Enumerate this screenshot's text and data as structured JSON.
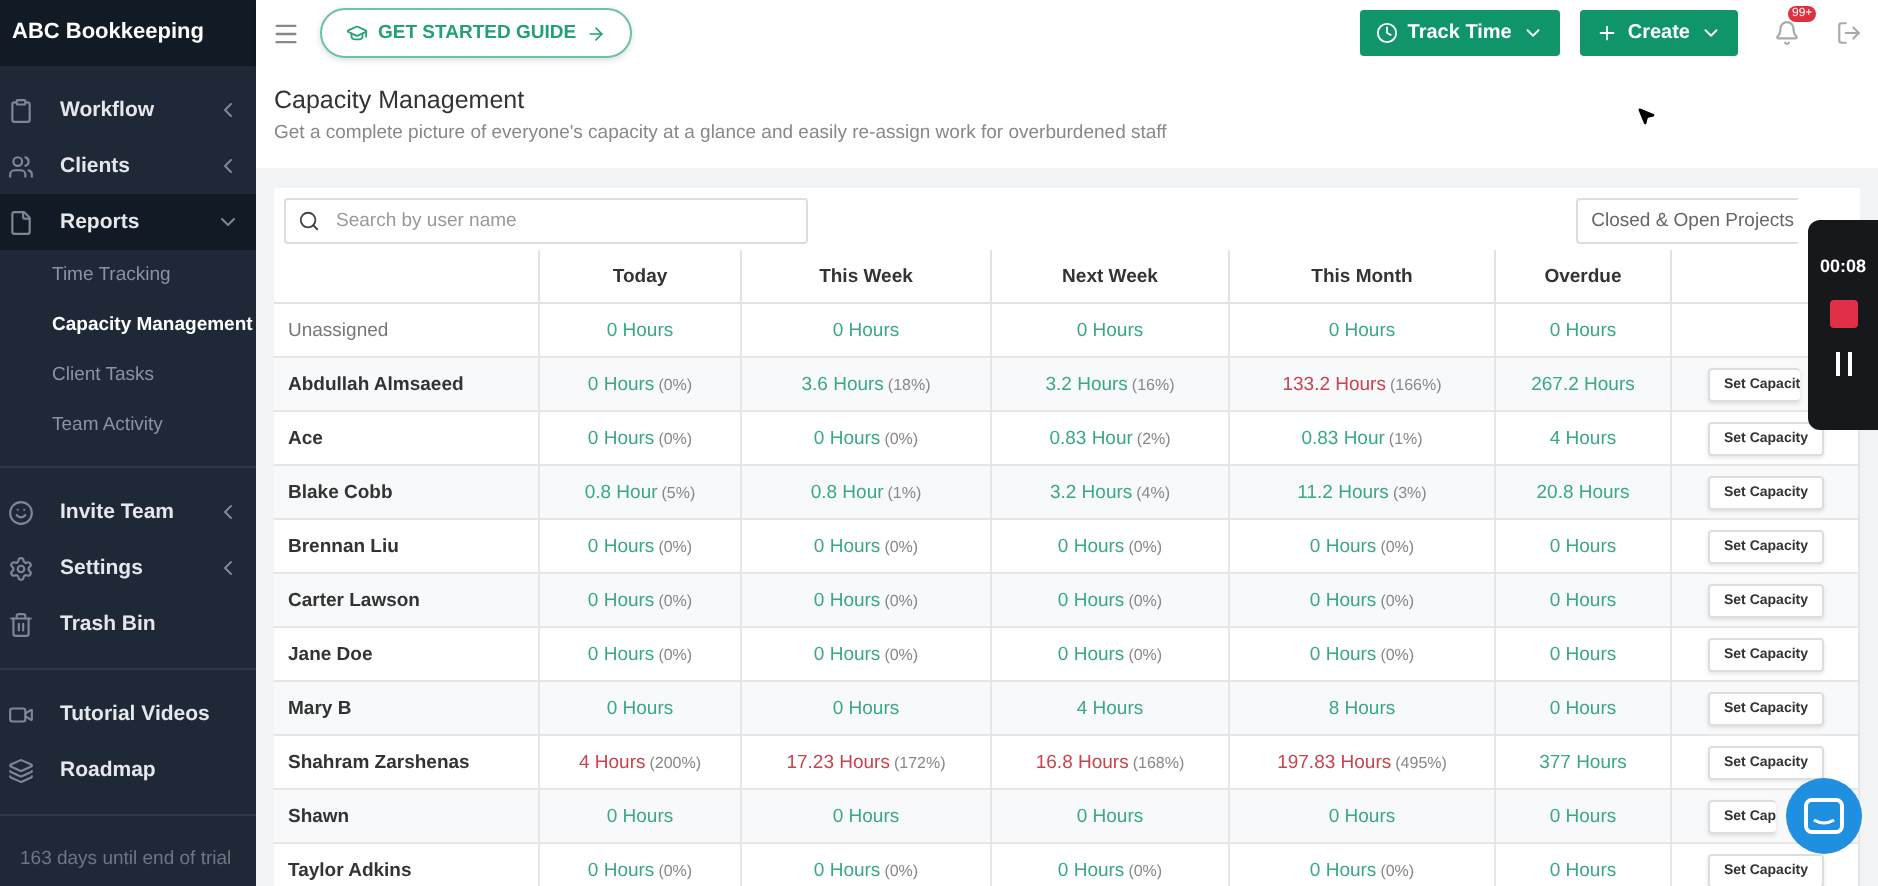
{
  "brand": "ABC Bookkeeping",
  "sidebar": {
    "groups": [
      {
        "items": [
          {
            "label": "Workflow",
            "expanded": false,
            "has_chevron": true
          },
          {
            "label": "Clients",
            "expanded": false,
            "has_chevron": true
          },
          {
            "label": "Reports",
            "expanded": true,
            "has_chevron": true,
            "children": [
              {
                "label": "Time Tracking",
                "selected": false
              },
              {
                "label": "Capacity Management",
                "selected": true
              },
              {
                "label": "Client Tasks",
                "selected": false
              },
              {
                "label": "Team Activity",
                "selected": false
              }
            ]
          }
        ]
      },
      {
        "items": [
          {
            "label": "Invite Team",
            "expanded": false,
            "has_chevron": true
          },
          {
            "label": "Settings",
            "expanded": false,
            "has_chevron": true
          },
          {
            "label": "Trash Bin",
            "expanded": false,
            "has_chevron": false
          }
        ]
      },
      {
        "items": [
          {
            "label": "Tutorial Videos",
            "expanded": false,
            "has_chevron": false
          },
          {
            "label": "Roadmap",
            "expanded": false,
            "has_chevron": false
          }
        ]
      }
    ],
    "trial_note": "163 days until end of trial"
  },
  "topbar": {
    "guide_button": "GET STARTED GUIDE",
    "track_button": "Track Time",
    "create_button": "Create",
    "notification_badge": "99+"
  },
  "page": {
    "title": "Capacity Management",
    "subtitle": "Get a complete picture of everyone's capacity at a glance and easily re-assign work for overburdened staff"
  },
  "search": {
    "placeholder": "Search by user name"
  },
  "filter": {
    "value": "Closed & Open Projects"
  },
  "table": {
    "columns": [
      "Today",
      "This Week",
      "Next Week",
      "This Month",
      "Overdue"
    ],
    "rows": [
      {
        "name": "Unassigned",
        "unassigned": true,
        "cells": [
          {
            "hours": "0 Hours",
            "over": false
          },
          {
            "hours": "0 Hours",
            "over": false
          },
          {
            "hours": "0 Hours",
            "over": false
          },
          {
            "hours": "0 Hours",
            "over": false
          },
          {
            "hours": "0 Hours",
            "over": false
          }
        ]
      },
      {
        "name": "Abdullah Almsaeed",
        "unassigned": false,
        "action": "Set Capacit",
        "action_cut": true,
        "cells": [
          {
            "hours": "0 Hours",
            "pct": "(0%)",
            "over": false
          },
          {
            "hours": "3.6 Hours",
            "pct": "(18%)",
            "over": false
          },
          {
            "hours": "3.2 Hours",
            "pct": "(16%)",
            "over": false
          },
          {
            "hours": "133.2 Hours",
            "pct": "(166%)",
            "over": true
          },
          {
            "hours": "267.2 Hours",
            "over": false
          }
        ]
      },
      {
        "name": "Ace",
        "unassigned": false,
        "action": "Set Capacity",
        "cells": [
          {
            "hours": "0 Hours",
            "pct": "(0%)",
            "over": false
          },
          {
            "hours": "0 Hours",
            "pct": "(0%)",
            "over": false
          },
          {
            "hours": "0.83 Hour",
            "pct": "(2%)",
            "over": false
          },
          {
            "hours": "0.83 Hour",
            "pct": "(1%)",
            "over": false
          },
          {
            "hours": "4 Hours",
            "over": false
          }
        ]
      },
      {
        "name": "Blake Cobb",
        "unassigned": false,
        "action": "Set Capacity",
        "cells": [
          {
            "hours": "0.8 Hour",
            "pct": "(5%)",
            "over": false
          },
          {
            "hours": "0.8 Hour",
            "pct": "(1%)",
            "over": false
          },
          {
            "hours": "3.2 Hours",
            "pct": "(4%)",
            "over": false
          },
          {
            "hours": "11.2 Hours",
            "pct": "(3%)",
            "over": false
          },
          {
            "hours": "20.8 Hours",
            "over": false
          }
        ]
      },
      {
        "name": "Brennan Liu",
        "unassigned": false,
        "action": "Set Capacity",
        "cells": [
          {
            "hours": "0 Hours",
            "pct": "(0%)",
            "over": false
          },
          {
            "hours": "0 Hours",
            "pct": "(0%)",
            "over": false
          },
          {
            "hours": "0 Hours",
            "pct": "(0%)",
            "over": false
          },
          {
            "hours": "0 Hours",
            "pct": "(0%)",
            "over": false
          },
          {
            "hours": "0 Hours",
            "over": false
          }
        ]
      },
      {
        "name": "Carter Lawson",
        "unassigned": false,
        "action": "Set Capacity",
        "cells": [
          {
            "hours": "0 Hours",
            "pct": "(0%)",
            "over": false
          },
          {
            "hours": "0 Hours",
            "pct": "(0%)",
            "over": false
          },
          {
            "hours": "0 Hours",
            "pct": "(0%)",
            "over": false
          },
          {
            "hours": "0 Hours",
            "pct": "(0%)",
            "over": false
          },
          {
            "hours": "0 Hours",
            "over": false
          }
        ]
      },
      {
        "name": "Jane Doe",
        "unassigned": false,
        "action": "Set Capacity",
        "cells": [
          {
            "hours": "0 Hours",
            "pct": "(0%)",
            "over": false
          },
          {
            "hours": "0 Hours",
            "pct": "(0%)",
            "over": false
          },
          {
            "hours": "0 Hours",
            "pct": "(0%)",
            "over": false
          },
          {
            "hours": "0 Hours",
            "pct": "(0%)",
            "over": false
          },
          {
            "hours": "0 Hours",
            "over": false
          }
        ]
      },
      {
        "name": "Mary B",
        "unassigned": false,
        "action": "Set Capacity",
        "cells": [
          {
            "hours": "0 Hours",
            "over": false
          },
          {
            "hours": "0 Hours",
            "over": false
          },
          {
            "hours": "4 Hours",
            "over": false
          },
          {
            "hours": "8 Hours",
            "over": false
          },
          {
            "hours": "0 Hours",
            "over": false
          }
        ]
      },
      {
        "name": "Shahram Zarshenas",
        "unassigned": false,
        "action": "Set Capacity",
        "cells": [
          {
            "hours": "4 Hours",
            "pct": "(200%)",
            "over": true
          },
          {
            "hours": "17.23 Hours",
            "pct": "(172%)",
            "over": true
          },
          {
            "hours": "16.8 Hours",
            "pct": "(168%)",
            "over": true
          },
          {
            "hours": "197.83 Hours",
            "pct": "(495%)",
            "over": true
          },
          {
            "hours": "377 Hours",
            "over": false
          }
        ]
      },
      {
        "name": "Shawn",
        "unassigned": false,
        "action": "Set Cap",
        "action_cut": true,
        "cells": [
          {
            "hours": "0 Hours",
            "over": false
          },
          {
            "hours": "0 Hours",
            "over": false
          },
          {
            "hours": "0 Hours",
            "over": false
          },
          {
            "hours": "0 Hours",
            "over": false
          },
          {
            "hours": "0 Hours",
            "over": false
          }
        ]
      },
      {
        "name": "Taylor Adkins",
        "unassigned": false,
        "action": "Set Capacity",
        "cells": [
          {
            "hours": "0 Hours",
            "pct": "(0%)",
            "over": false
          },
          {
            "hours": "0 Hours",
            "pct": "(0%)",
            "over": false
          },
          {
            "hours": "0 Hours",
            "pct": "(0%)",
            "over": false
          },
          {
            "hours": "0 Hours",
            "pct": "(0%)",
            "over": false
          },
          {
            "hours": "0 Hours",
            "over": false
          }
        ]
      }
    ]
  },
  "recorder": {
    "time": "00:08"
  }
}
